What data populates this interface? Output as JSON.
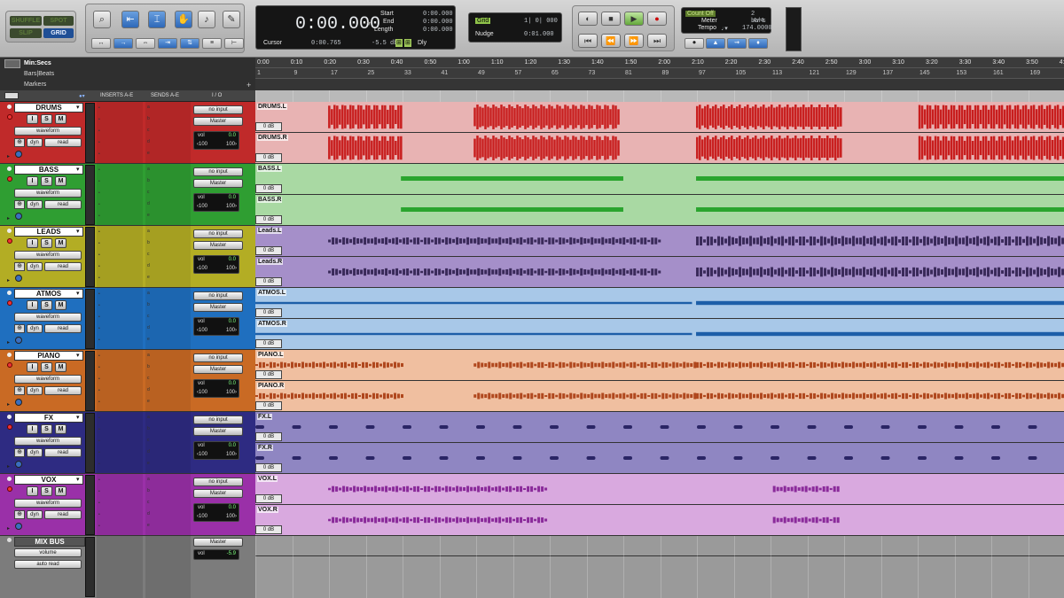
{
  "edit_modes": {
    "shuffle": "SHUFFLE",
    "spot": "SPOT",
    "slip": "SLIP",
    "grid": "GRID"
  },
  "counter": {
    "main": "0:00.000",
    "cursor_label": "Cursor",
    "cursor_value": "0:00.765",
    "cursor_db": "-5.5 db",
    "dly": "Dly",
    "start_label": "Start",
    "start_value": "0:00.000",
    "end_label": "End",
    "end_value": "0:00.000",
    "length_label": "Length",
    "length_value": "0:00.000"
  },
  "grid": {
    "label": "Grid",
    "value": "1| 0| 000",
    "nudge_label": "Nudge",
    "nudge_value": "0:01.000"
  },
  "midi": {
    "count_off": "Count Off",
    "bars": "2 bars",
    "meter_label": "Meter",
    "meter_value": "4/4",
    "tempo_label": "Tempo",
    "tempo_value": "174.0000"
  },
  "rulers": {
    "minsecs": "Min:Secs",
    "barsbeats": "Bars|Beats",
    "markers": "Markers",
    "minsec_ticks": [
      "0:00",
      "0:10",
      "0:20",
      "0:30",
      "0:40",
      "0:50",
      "1:00",
      "1:10",
      "1:20",
      "1:30",
      "1:40",
      "1:50",
      "2:00",
      "2:10",
      "2:20",
      "2:30",
      "2:40",
      "2:50",
      "3:00",
      "3:10",
      "3:20",
      "3:30",
      "3:40",
      "3:50",
      "4:"
    ],
    "bar_ticks": [
      "1",
      "9",
      "17",
      "25",
      "33",
      "41",
      "49",
      "57",
      "65",
      "73",
      "81",
      "89",
      "97",
      "105",
      "113",
      "121",
      "129",
      "137",
      "145",
      "153",
      "161",
      "169"
    ]
  },
  "columns": {
    "inserts": "INSERTS A-E",
    "sends": "SENDS A-E",
    "io": "I / O"
  },
  "labels": {
    "s": "S",
    "m": "M",
    "i": "I",
    "waveform": "waveform",
    "dyn": "dyn",
    "read": "read",
    "no_input": "no input",
    "master": "Master",
    "vol": "vol",
    "vol_value": "0.0",
    "pan_l": "‹100",
    "pan_r": "100›",
    "db": "0 dB",
    "volume": "volume",
    "auto_read": "auto read",
    "mix_vol": "-5.9",
    "send_letters": [
      "a",
      "b",
      "c",
      "d",
      "e"
    ]
  },
  "tracks": [
    {
      "name": "DRUMS",
      "color": "#c02a2a",
      "lane": "#e8b3b3",
      "wave": "#c81e1e",
      "clipL": "DRUMS.L",
      "clipR": "DRUMS.R"
    },
    {
      "name": "BASS",
      "color": "#2f9e32",
      "lane": "#a9d9a3",
      "wave": "#2aa52e",
      "clipL": "BASS.L",
      "clipR": "BASS.R"
    },
    {
      "name": "LEADS",
      "color": "#b3ad24",
      "lane": "#a58fc9",
      "wave": "#3a2a5a",
      "clipL": "Leads.L",
      "clipR": "Leads.R"
    },
    {
      "name": "ATMOS",
      "color": "#1f6fbf",
      "lane": "#a8c8e8",
      "wave": "#1d5ea8",
      "clipL": "ATMOS.L",
      "clipR": "ATMOS.R"
    },
    {
      "name": "PIANO",
      "color": "#c96a24",
      "lane": "#f0bfa0",
      "wave": "#b0481e",
      "clipL": "PIANO.L",
      "clipR": "PIANO.R"
    },
    {
      "name": "FX",
      "color": "#2e2b82",
      "lane": "#8f86c2",
      "wave": "#2a2565",
      "clipL": "FX.L",
      "clipR": "FX.R"
    },
    {
      "name": "VOX",
      "color": "#9a30a8",
      "lane": "#d9a9df",
      "wave": "#8a2a9a",
      "clipL": "VOX.L",
      "clipR": "VOX.R"
    }
  ],
  "mixbus": {
    "name": "MIX BUS"
  }
}
